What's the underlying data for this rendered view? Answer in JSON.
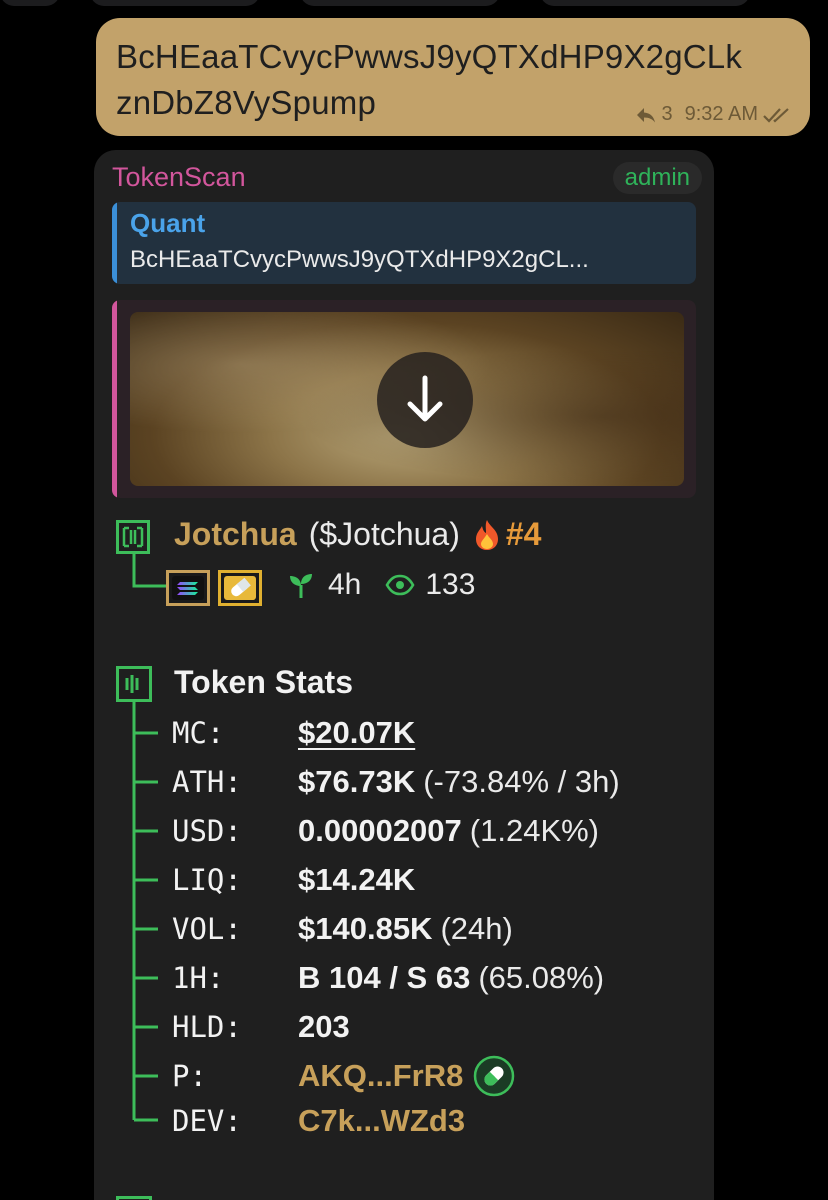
{
  "outgoing": {
    "text_line1": "BcHEaaTCvycPwwsJ9yQTXdHP9X2gCLk",
    "text_line2": "znDbZ8VySpump",
    "reply_count": "3",
    "time": "9:32 AM",
    "status_icon": "double-check-icon"
  },
  "incoming": {
    "sender": "TokenScan",
    "role_badge": "admin",
    "quote": {
      "name": "Quant",
      "text": "BcHEaaTCvycPwwsJ9yQTXdHP9X2gCL..."
    },
    "media": {
      "icon": "download-icon"
    },
    "token": {
      "name": "Jotchua",
      "symbol": "($Jotchua)",
      "rank": "#4",
      "age": "4h",
      "views": "133",
      "chips": [
        "solana-icon",
        "pill-icon"
      ]
    },
    "stats": {
      "title": "Token Stats",
      "rows": [
        {
          "label": "MC:",
          "value": "$20.07K",
          "suffix": ""
        },
        {
          "label": "ATH:",
          "value": "$76.73K",
          "suffix": "(-73.84% / 3h)"
        },
        {
          "label": "USD:",
          "value": "0.00002007",
          "suffix": "(1.24K%)"
        },
        {
          "label": "LIQ:",
          "value": "$14.24K",
          "suffix": ""
        },
        {
          "label": "VOL:",
          "value": "$140.85K",
          "suffix": "(24h)"
        },
        {
          "label": "1H:",
          "value": "B 104 / S 63",
          "suffix": "(65.08%)"
        },
        {
          "label": "HLD:",
          "value": "203",
          "suffix": ""
        },
        {
          "label": "P:",
          "value": "AKQ...FrR8",
          "suffix": ""
        },
        {
          "label": "DEV:",
          "value": "C7k...WZd3",
          "suffix": ""
        }
      ]
    }
  },
  "colors": {
    "bubble_out": "#c2a26a",
    "card_bg": "#1f1f1f",
    "accent_green": "#3dbd5a",
    "gold": "#c7a05a",
    "sender_pink": "#d2569c",
    "quote_blue": "#4aa3ea"
  }
}
